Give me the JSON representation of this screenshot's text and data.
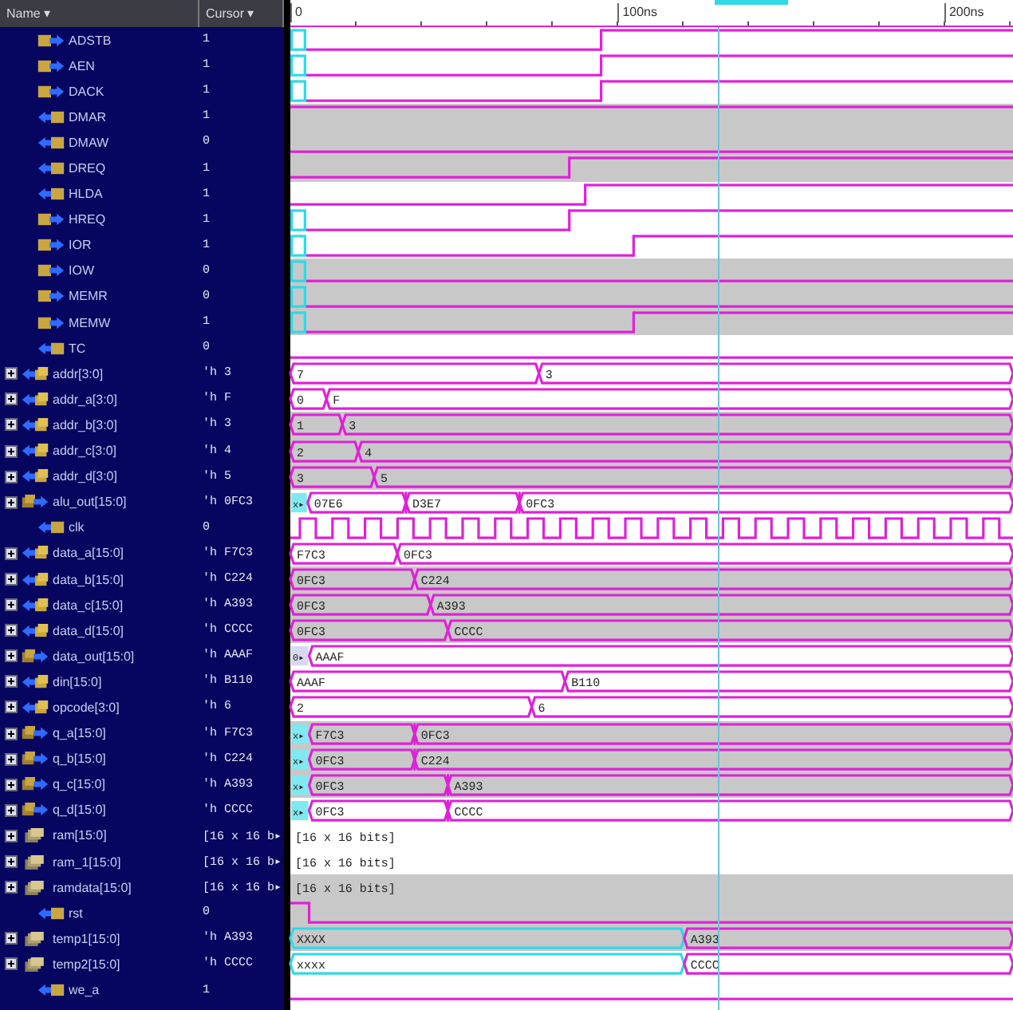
{
  "headers": {
    "name": "Name ▾",
    "cursor": "Cursor ▾"
  },
  "timeline": {
    "ticks": [
      {
        "label": "0",
        "level": 0
      },
      {
        "label": "100ns",
        "level": 0.453
      },
      {
        "label": "200ns",
        "level": 0.905
      }
    ]
  },
  "cursor": {
    "level": 0.592
  },
  "signals": [
    {
      "name": "ADSTB",
      "kind": "out",
      "value": "1",
      "highlighted": false,
      "segments": [
        {
          "kind": "x",
          "level": 0.022
        },
        {
          "kind": "low",
          "level": 0.43
        },
        {
          "kind": "high"
        }
      ]
    },
    {
      "name": "AEN",
      "kind": "out",
      "value": "1",
      "highlighted": false,
      "segments": [
        {
          "kind": "x",
          "level": 0.022
        },
        {
          "kind": "low",
          "level": 0.43
        },
        {
          "kind": "high"
        }
      ]
    },
    {
      "name": "DACK",
      "kind": "out",
      "value": "1",
      "highlighted": false,
      "segments": [
        {
          "kind": "x",
          "level": 0.022
        },
        {
          "kind": "low",
          "level": 0.43
        },
        {
          "kind": "high"
        }
      ]
    },
    {
      "name": "DMAR",
      "kind": "in",
      "value": "1",
      "highlighted": true,
      "segments": [
        {
          "kind": "high"
        }
      ]
    },
    {
      "name": "DMAW",
      "kind": "in",
      "value": "0",
      "highlighted": true,
      "segments": [
        {
          "kind": "low"
        }
      ]
    },
    {
      "name": "DREQ",
      "kind": "in",
      "value": "1",
      "highlighted": true,
      "segments": [
        {
          "kind": "low",
          "level": 0.386
        },
        {
          "kind": "high"
        }
      ]
    },
    {
      "name": "HLDA",
      "kind": "in",
      "value": "1",
      "highlighted": false,
      "segments": [
        {
          "kind": "low",
          "level": 0.408
        },
        {
          "kind": "high"
        }
      ]
    },
    {
      "name": "HREQ",
      "kind": "out",
      "value": "1",
      "highlighted": false,
      "segments": [
        {
          "kind": "x",
          "level": 0.022
        },
        {
          "kind": "low",
          "level": 0.386
        },
        {
          "kind": "high"
        }
      ]
    },
    {
      "name": "IOR",
      "kind": "out",
      "value": "1",
      "highlighted": false,
      "segments": [
        {
          "kind": "x",
          "level": 0.022
        },
        {
          "kind": "low",
          "level": 0.475
        },
        {
          "kind": "high"
        }
      ]
    },
    {
      "name": "IOW",
      "kind": "out",
      "value": "0",
      "highlighted": true,
      "segments": [
        {
          "kind": "x",
          "level": 0.022
        },
        {
          "kind": "low"
        }
      ]
    },
    {
      "name": "MEMR",
      "kind": "out",
      "value": "0",
      "highlighted": true,
      "segments": [
        {
          "kind": "x",
          "level": 0.022
        },
        {
          "kind": "low"
        }
      ]
    },
    {
      "name": "MEMW",
      "kind": "out",
      "value": "1",
      "highlighted": true,
      "segments": [
        {
          "kind": "x",
          "level": 0.022
        },
        {
          "kind": "low",
          "level": 0.475
        },
        {
          "kind": "high"
        }
      ]
    },
    {
      "name": "TC",
      "kind": "in",
      "value": "0",
      "highlighted": false,
      "segments": [
        {
          "kind": "low"
        }
      ]
    },
    {
      "name": "addr[3:0]",
      "kind": "bus_in",
      "expanded": false,
      "value": "'h 3",
      "highlighted": false,
      "segments": [
        {
          "kind": "bus",
          "value": "7",
          "level": 0.344
        },
        {
          "kind": "bus",
          "value": "3"
        }
      ]
    },
    {
      "name": "addr_a[3:0]",
      "kind": "bus_in",
      "expanded": false,
      "value": "'h F",
      "highlighted": false,
      "segments": [
        {
          "kind": "bus",
          "value": "0",
          "level": 0.05
        },
        {
          "kind": "bus",
          "value": "F"
        }
      ]
    },
    {
      "name": "addr_b[3:0]",
      "kind": "bus_in",
      "expanded": false,
      "value": "'h 3",
      "highlighted": true,
      "segments": [
        {
          "kind": "bus",
          "value": "1",
          "level": 0.072
        },
        {
          "kind": "bus",
          "value": "3"
        }
      ]
    },
    {
      "name": "addr_c[3:0]",
      "kind": "bus_in",
      "expanded": false,
      "value": "'h 4",
      "highlighted": true,
      "segments": [
        {
          "kind": "bus",
          "value": "2",
          "level": 0.094
        },
        {
          "kind": "bus",
          "value": "4"
        }
      ]
    },
    {
      "name": "addr_d[3:0]",
      "kind": "bus_in",
      "expanded": false,
      "value": "'h 5",
      "highlighted": true,
      "segments": [
        {
          "kind": "bus",
          "value": "3",
          "level": 0.116
        },
        {
          "kind": "bus",
          "value": "5"
        }
      ]
    },
    {
      "name": "alu_out[15:0]",
      "kind": "bus_out",
      "expanded": false,
      "value": "'h 0FC3",
      "highlighted": false,
      "segments": [
        {
          "kind": "x",
          "value": "x▸",
          "level": 0.024
        },
        {
          "kind": "bus",
          "value": "07E6",
          "level": 0.16
        },
        {
          "kind": "bus",
          "value": "D3E7",
          "level": 0.317
        },
        {
          "kind": "bus",
          "value": "0FC3"
        }
      ]
    },
    {
      "name": "clk",
      "kind": "in",
      "value": "0",
      "highlighted": false,
      "segments": [
        {
          "kind": "clock"
        }
      ]
    },
    {
      "name": "data_a[15:0]",
      "kind": "bus_in",
      "expanded": false,
      "value": "'h F7C3",
      "highlighted": false,
      "segments": [
        {
          "kind": "bus",
          "value": "F7C3",
          "level": 0.148
        },
        {
          "kind": "bus",
          "value": "0FC3"
        }
      ]
    },
    {
      "name": "data_b[15:0]",
      "kind": "bus_in",
      "expanded": false,
      "value": "'h C224",
      "highlighted": true,
      "segments": [
        {
          "kind": "bus",
          "value": "0FC3",
          "level": 0.172
        },
        {
          "kind": "bus",
          "value": "C224"
        }
      ]
    },
    {
      "name": "data_c[15:0]",
      "kind": "bus_in",
      "expanded": false,
      "value": "'h A393",
      "highlighted": true,
      "segments": [
        {
          "kind": "bus",
          "value": "0FC3",
          "level": 0.194
        },
        {
          "kind": "bus",
          "value": "A393"
        }
      ]
    },
    {
      "name": "data_d[15:0]",
      "kind": "bus_in",
      "expanded": false,
      "value": "'h CCCC",
      "highlighted": true,
      "segments": [
        {
          "kind": "bus",
          "value": "0FC3",
          "level": 0.218
        },
        {
          "kind": "bus",
          "value": "CCCC"
        }
      ]
    },
    {
      "name": "data_out[15:0]",
      "kind": "bus_out",
      "expanded": false,
      "value": "'h AAAF",
      "highlighted": false,
      "segments": [
        {
          "kind": "z",
          "value": "0▸",
          "level": 0.026
        },
        {
          "kind": "bus",
          "value": "AAAF"
        }
      ]
    },
    {
      "name": "din[15:0]",
      "kind": "bus_in",
      "expanded": false,
      "value": "'h B110",
      "highlighted": false,
      "segments": [
        {
          "kind": "bus",
          "value": "AAAF",
          "level": 0.38
        },
        {
          "kind": "bus",
          "value": "B110"
        }
      ]
    },
    {
      "name": "opcode[3:0]",
      "kind": "bus_in",
      "expanded": false,
      "value": "'h 6",
      "highlighted": false,
      "segments": [
        {
          "kind": "bus",
          "value": "2",
          "level": 0.334
        },
        {
          "kind": "bus",
          "value": "6"
        }
      ]
    },
    {
      "name": "q_a[15:0]",
      "kind": "bus_out",
      "expanded": false,
      "value": "'h F7C3",
      "highlighted": true,
      "segments": [
        {
          "kind": "x",
          "value": "x▸",
          "level": 0.026
        },
        {
          "kind": "bus",
          "value": "F7C3",
          "level": 0.172
        },
        {
          "kind": "bus",
          "value": "0FC3"
        }
      ]
    },
    {
      "name": "q_b[15:0]",
      "kind": "bus_out",
      "expanded": false,
      "value": "'h C224",
      "highlighted": true,
      "segments": [
        {
          "kind": "x",
          "value": "x▸",
          "level": 0.026
        },
        {
          "kind": "bus",
          "value": "0FC3",
          "level": 0.172
        },
        {
          "kind": "bus",
          "value": "C224"
        }
      ]
    },
    {
      "name": "q_c[15:0]",
      "kind": "bus_out",
      "expanded": false,
      "value": "'h A393",
      "highlighted": true,
      "segments": [
        {
          "kind": "x",
          "value": "x▸",
          "level": 0.026
        },
        {
          "kind": "bus",
          "value": "0FC3",
          "level": 0.218
        },
        {
          "kind": "bus",
          "value": "A393"
        }
      ]
    },
    {
      "name": "q_d[15:0]",
      "kind": "bus_out",
      "expanded": false,
      "value": "'h CCCC",
      "highlighted": false,
      "segments": [
        {
          "kind": "x",
          "value": "x▸",
          "level": 0.026
        },
        {
          "kind": "bus",
          "value": "0FC3",
          "level": 0.218
        },
        {
          "kind": "bus",
          "value": "CCCC"
        }
      ]
    },
    {
      "name": "ram[15:0]",
      "kind": "mem",
      "expanded": false,
      "value": "[16 x 16 b▸",
      "highlighted": false,
      "segments": [
        {
          "kind": "array",
          "value": "[16 x 16 bits]"
        }
      ]
    },
    {
      "name": "ram_1[15:0]",
      "kind": "mem",
      "expanded": false,
      "value": "[16 x 16 b▸",
      "highlighted": false,
      "segments": [
        {
          "kind": "array",
          "value": "[16 x 16 bits]"
        }
      ]
    },
    {
      "name": "ramdata[15:0]",
      "kind": "mem",
      "expanded": false,
      "value": "[16 x 16 b▸",
      "highlighted": true,
      "segments": [
        {
          "kind": "array",
          "value": "[16 x 16 bits]"
        }
      ]
    },
    {
      "name": "rst",
      "kind": "in",
      "value": "0",
      "highlighted": true,
      "segments": [
        {
          "kind": "high",
          "level": 0.026
        },
        {
          "kind": "low"
        }
      ]
    },
    {
      "name": "temp1[15:0]",
      "kind": "mem",
      "expanded": false,
      "value": "'h A393",
      "highlighted": true,
      "segments": [
        {
          "kind": "x",
          "value": "XXXX",
          "level": 0.545
        },
        {
          "kind": "bus",
          "value": "A393"
        }
      ]
    },
    {
      "name": "temp2[15:0]",
      "kind": "mem",
      "expanded": false,
      "value": "'h CCCC",
      "highlighted": false,
      "segments": [
        {
          "kind": "x",
          "value": "xxxx",
          "level": 0.545
        },
        {
          "kind": "bus",
          "value": "CCCC"
        }
      ]
    },
    {
      "name": "we_a",
      "kind": "in",
      "value": "1",
      "highlighted": false,
      "segments": [
        {
          "kind": "low"
        }
      ]
    }
  ]
}
